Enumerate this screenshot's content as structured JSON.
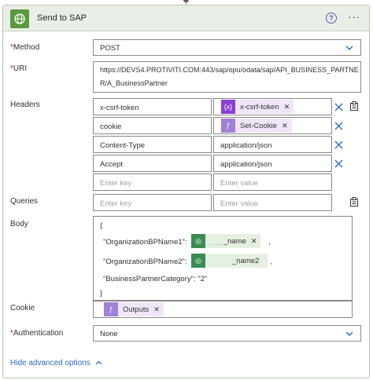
{
  "action": {
    "title": "Send to SAP",
    "help_icon": "question-circle-icon",
    "more_icon": "ellipsis-icon"
  },
  "fields": {
    "method": {
      "label": "Method",
      "required": "*",
      "value": "POST"
    },
    "uri": {
      "label": "URI",
      "required": "*",
      "line1": "https://DEVS4.PROTIVITI.COM:443/sap/opu/odata/sap/API_BUSINESS_PARTNE",
      "line2": "R/A_BusinessPartner"
    },
    "headers": {
      "label": "Headers",
      "rows": [
        {
          "key": "x-csrf-token",
          "value_token": "x-csrf-token",
          "token_type": "variable"
        },
        {
          "key": "cookie",
          "value_token": "Set-Cookie",
          "token_type": "expression"
        },
        {
          "key": "Content-Type",
          "value": "application/json"
        },
        {
          "key": "Accept",
          "value": "application/json"
        }
      ],
      "key_placeholder": "Enter key",
      "value_placeholder": "Enter value"
    },
    "queries": {
      "label": "Queries",
      "key_placeholder": "Enter key",
      "value_placeholder": "Enter value"
    },
    "body": {
      "label": "Body",
      "open_brace": "{",
      "name1_key": "\"OrganizationBPName1\":",
      "name1_token": "_name",
      "name1_hidden": "___",
      "name2_key": "\"OrganizationBPName2\":",
      "name2_token": "_name2",
      "comma": ",",
      "category_line": "\"BusinessPartnerCategory\": \"2\"",
      "close_brace": "}"
    },
    "cookie": {
      "label": "Cookie",
      "token": "Outputs"
    },
    "authentication": {
      "label": "Authentication",
      "required": "*",
      "value": "None"
    }
  },
  "footer": {
    "hide_advanced": "Hide advanced options"
  },
  "colors": {
    "header_bg": "#e9efe6",
    "app_icon": "#5a9a3e",
    "variable_token": "#8a3fd4",
    "expression_token": "#a181d6",
    "dynamic_token": "#3a8d52",
    "link": "#2b69c6",
    "accent": "#2b6cc4"
  }
}
